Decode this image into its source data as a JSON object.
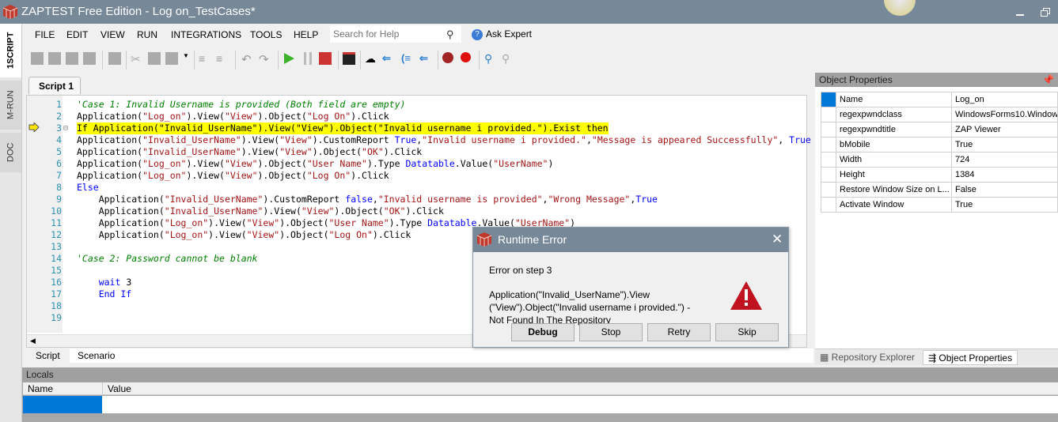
{
  "window": {
    "title": "ZAPTEST Free Edition - Log on_TestCases*"
  },
  "side_tabs": [
    {
      "label": "1SCRIPT"
    },
    {
      "label": "M-RUN"
    },
    {
      "label": "DOC"
    }
  ],
  "menu": [
    "FILE",
    "EDIT",
    "VIEW",
    "RUN",
    "INTEGRATIONS",
    "TOOLS",
    "HELP"
  ],
  "search": {
    "placeholder": "Search for Help"
  },
  "ask_expert": "Ask Expert",
  "editor_tab": "Script 1",
  "colors": {
    "titlebar": "#778899",
    "keyword": "#0000ff",
    "string": "#a31515",
    "comment": "#008000",
    "highlight": "#ffff00",
    "selection": "#0078d7"
  },
  "code": {
    "current_line": 3,
    "lines": [
      [
        [
          "c",
          "'Case 1: Invalid Username is provided (Both field are empty)"
        ]
      ],
      [
        [
          "p",
          "Application("
        ],
        [
          "s",
          "\"Log_on\""
        ],
        [
          "p",
          ").View("
        ],
        [
          "s",
          "\"View\""
        ],
        [
          "p",
          ").Object("
        ],
        [
          "s",
          "\"Log On\""
        ],
        [
          "p",
          ").Click"
        ]
      ],
      [
        [
          "p",
          "If Application(\"Invalid_UserName\").View(\"View\").Object(\"Invalid username i provided.\").Exist then"
        ]
      ],
      [
        [
          "p",
          "Application("
        ],
        [
          "s",
          "\"Invalid_UserName\""
        ],
        [
          "p",
          ").View("
        ],
        [
          "s",
          "\"View\""
        ],
        [
          "p",
          ").CustomReport "
        ],
        [
          "k",
          "True"
        ],
        [
          "p",
          ","
        ],
        [
          "s",
          "\"Invalid username i provided.\""
        ],
        [
          "p",
          ","
        ],
        [
          "s",
          "\"Message is appeared Successfully\""
        ],
        [
          "p",
          ", "
        ],
        [
          "k",
          "True"
        ]
      ],
      [
        [
          "p",
          "Application("
        ],
        [
          "s",
          "\"Invalid_UserName\""
        ],
        [
          "p",
          ").View("
        ],
        [
          "s",
          "\"View\""
        ],
        [
          "p",
          ").Object("
        ],
        [
          "s",
          "\"OK\""
        ],
        [
          "p",
          ").Click"
        ]
      ],
      [
        [
          "p",
          "Application("
        ],
        [
          "s",
          "\"Log_on\""
        ],
        [
          "p",
          ").View("
        ],
        [
          "s",
          "\"View\""
        ],
        [
          "p",
          ").Object("
        ],
        [
          "s",
          "\"User Name\""
        ],
        [
          "p",
          ").Type "
        ],
        [
          "k",
          "Datatable"
        ],
        [
          "p",
          ".Value("
        ],
        [
          "s",
          "\"UserName\""
        ],
        [
          "p",
          ")"
        ]
      ],
      [
        [
          "p",
          "Application("
        ],
        [
          "s",
          "\"Log_on\""
        ],
        [
          "p",
          ").View("
        ],
        [
          "s",
          "\"View\""
        ],
        [
          "p",
          ").Object("
        ],
        [
          "s",
          "\"Log On\""
        ],
        [
          "p",
          ").Click"
        ]
      ],
      [
        [
          "k",
          "Else"
        ]
      ],
      [
        [
          "p",
          "    Application("
        ],
        [
          "s",
          "\"Invalid_UserName\""
        ],
        [
          "p",
          ").CustomReport "
        ],
        [
          "k",
          "false"
        ],
        [
          "p",
          ","
        ],
        [
          "s",
          "\"Invalid username is provided\""
        ],
        [
          "p",
          ","
        ],
        [
          "s",
          "\"Wrong Message\""
        ],
        [
          "p",
          ","
        ],
        [
          "k",
          "True"
        ]
      ],
      [
        [
          "p",
          "    Application("
        ],
        [
          "s",
          "\"Invalid_UserName\""
        ],
        [
          "p",
          ").View("
        ],
        [
          "s",
          "\"View\""
        ],
        [
          "p",
          ").Object("
        ],
        [
          "s",
          "\"OK\""
        ],
        [
          "p",
          ").Click"
        ]
      ],
      [
        [
          "p",
          "    Application("
        ],
        [
          "s",
          "\"Log_on\""
        ],
        [
          "p",
          ").View("
        ],
        [
          "s",
          "\"View\""
        ],
        [
          "p",
          ").Object("
        ],
        [
          "s",
          "\"User Name\""
        ],
        [
          "p",
          ").Type "
        ],
        [
          "k",
          "Datatable"
        ],
        [
          "p",
          ".Value("
        ],
        [
          "s",
          "\"UserName\""
        ],
        [
          "p",
          ")"
        ]
      ],
      [
        [
          "p",
          "    Application("
        ],
        [
          "s",
          "\"Log_on\""
        ],
        [
          "p",
          ").View("
        ],
        [
          "s",
          "\"View\""
        ],
        [
          "p",
          ").Object("
        ],
        [
          "s",
          "\"Log On\""
        ],
        [
          "p",
          ").Click"
        ]
      ],
      [],
      [
        [
          "c",
          "'Case 2: Password cannot be blank"
        ]
      ],
      [],
      [
        [
          "k",
          "    wait "
        ],
        [
          "p",
          "3"
        ]
      ],
      [
        [
          "k",
          "    End If"
        ]
      ],
      [],
      []
    ]
  },
  "bottom_tabs": [
    "Script",
    "Scenario"
  ],
  "locals": {
    "title": "Locals",
    "columns": [
      "Name",
      "Value"
    ]
  },
  "object_properties": {
    "title": "Object Properties",
    "rows": [
      [
        "Name",
        "Log_on"
      ],
      [
        "regexpwndclass",
        "WindowsForms10.Window."
      ],
      [
        "regexpwndtitle",
        "ZAP Viewer"
      ],
      [
        "bMobile",
        "True"
      ],
      [
        "Width",
        "724"
      ],
      [
        "Height",
        "1384"
      ],
      [
        "Restore Window Size on L...",
        "False"
      ],
      [
        "Activate Window",
        "True"
      ]
    ],
    "tabs": [
      "Repository Explorer",
      "Object Properties"
    ],
    "active_tab": 1
  },
  "dialog": {
    "title": "Runtime Error",
    "step": "Error on step 3",
    "message1": "Application(\"Invalid_UserName\").View",
    "message2": "(\"View\").Object(\"Invalid username i provided.\") -",
    "message3": "Not Found In The Repository",
    "buttons": [
      "Debug",
      "Stop",
      "Retry",
      "Skip"
    ]
  }
}
